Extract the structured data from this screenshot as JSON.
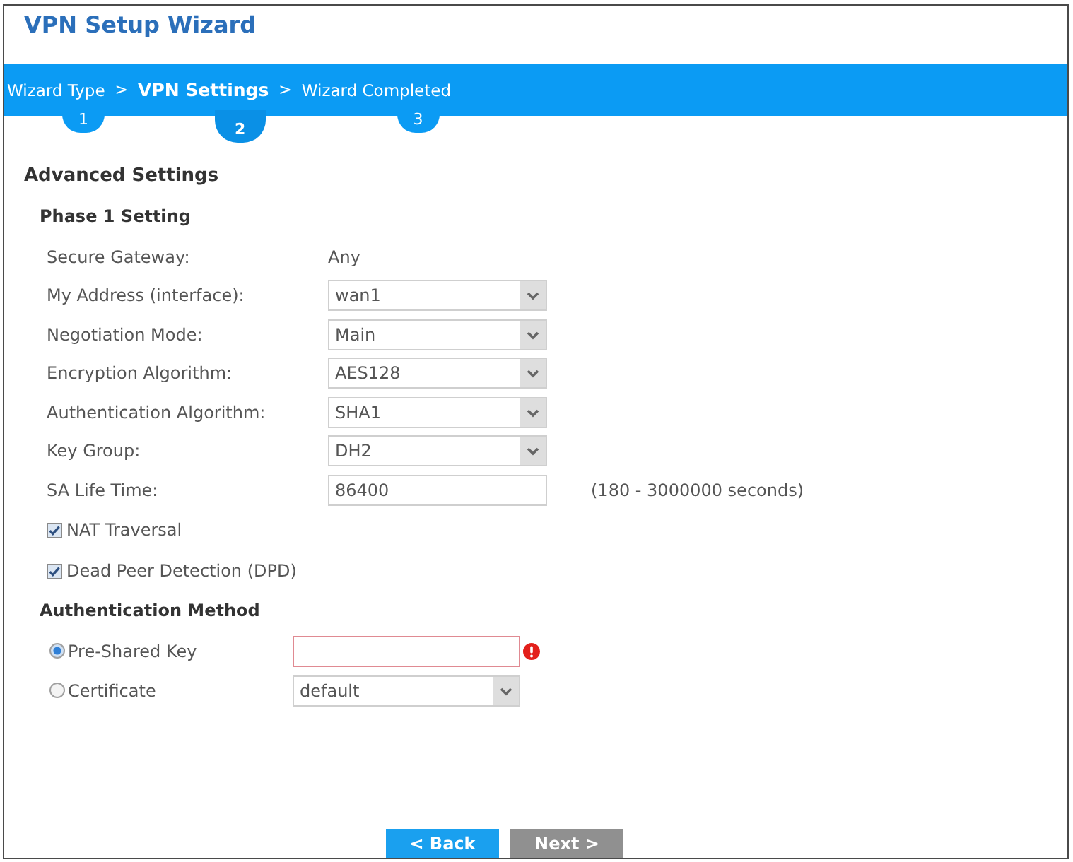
{
  "window": {
    "title": "VPN Setup Wizard"
  },
  "steps": [
    {
      "label": "Wizard Type",
      "number": "1",
      "separator": ">",
      "selected": false
    },
    {
      "label": "VPN Settings",
      "number": "2",
      "separator": ">",
      "selected": true
    },
    {
      "label": "Wizard Completed",
      "number": "3",
      "selected": false
    }
  ],
  "section": {
    "title": "Advanced Settings"
  },
  "phase1": {
    "title": "Phase 1 Setting",
    "fields": [
      {
        "kind": "text",
        "label": "Secure Gateway:",
        "value": "Any"
      },
      {
        "kind": "select",
        "label": "My Address (interface):",
        "value": "wan1"
      },
      {
        "kind": "select",
        "label": "Negotiation Mode:",
        "value": "Main"
      },
      {
        "kind": "select",
        "label": "Encryption Algorithm:",
        "value": "AES128"
      },
      {
        "kind": "select",
        "label": "Authentication Algorithm:",
        "value": "SHA1"
      },
      {
        "kind": "select",
        "label": "Key Group:",
        "value": "DH2"
      },
      {
        "kind": "input",
        "label": "SA Life Time:",
        "value": "86400",
        "hint": "(180 - 3000000 seconds)"
      }
    ],
    "options": [
      {
        "label": "NAT Traversal",
        "checked": true
      },
      {
        "label": "Dead Peer Detection (DPD)",
        "checked": true
      }
    ]
  },
  "auth": {
    "title": "Authentication Method",
    "methods": [
      {
        "kind": "input",
        "label": "Pre-Shared Key",
        "selected": true,
        "error": true
      },
      {
        "kind": "select",
        "label": "Certificate",
        "selected": false,
        "value": "default"
      }
    ]
  },
  "buttons": [
    {
      "label": "< Back",
      "disabled": false
    },
    {
      "label": "Next >",
      "disabled": true
    }
  ]
}
